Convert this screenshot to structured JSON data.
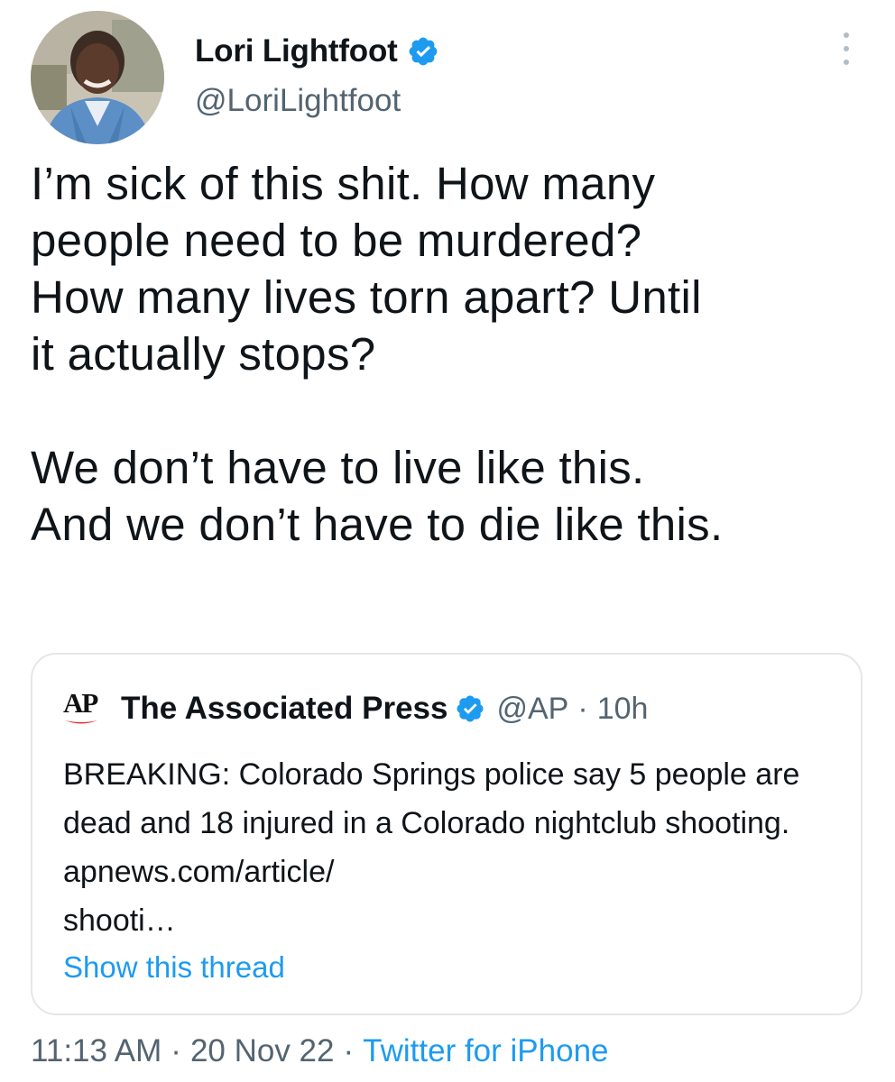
{
  "author": {
    "display_name": "Lori Lightfoot",
    "handle": "@LoriLightfoot",
    "verified": true
  },
  "tweet": {
    "paragraphs": [
      "I’m sick of this shit. How many\npeople need to be murdered?\nHow many lives torn apart? Until\nit actually stops?",
      "We don’t have to live like this.\nAnd we don’t have to die like this."
    ]
  },
  "quoted_tweet": {
    "logo_text": "AP",
    "display_name": "The Associated Press",
    "handle": "@AP",
    "separator": "·",
    "time": "10h",
    "verified": true,
    "text": "BREAKING: Colorado Springs police say 5 people are dead and 18 injured in a Colorado nightclub shooting. apnews.com/article/\nshooti…",
    "show_thread": "Show this thread"
  },
  "meta": {
    "time": "11:13 AM",
    "separator": "·",
    "date": "20 Nov 22",
    "source": "Twitter for iPhone"
  },
  "icons": {
    "verified": "verified-badge-icon",
    "more": "more-vertical-icon"
  },
  "colors": {
    "accent": "#1d9bf0",
    "secondary_text": "#536471",
    "primary_text": "#0f1419",
    "border": "#e3e7ea"
  }
}
